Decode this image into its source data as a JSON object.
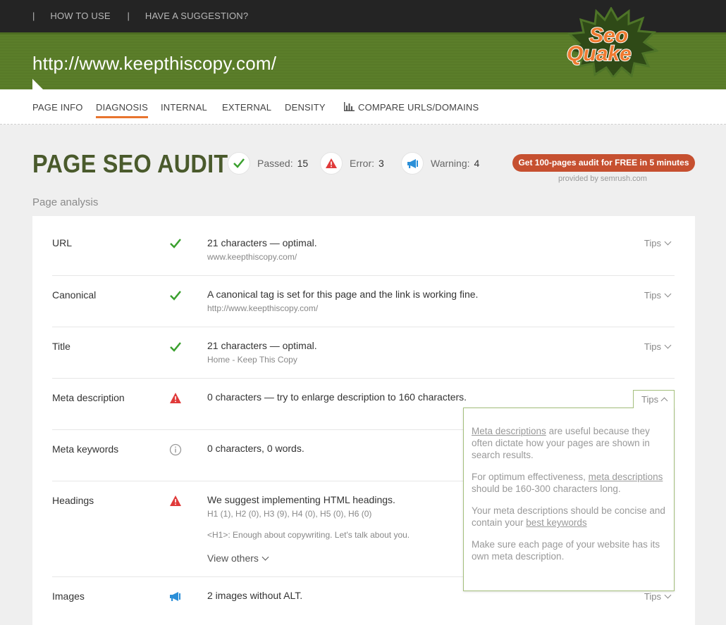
{
  "topnav": {
    "sep": "|",
    "how_to_use": "HOW TO USE",
    "suggestion": "HAVE A SUGGESTION?"
  },
  "site_url": "http://www.keepthiscopy.com/",
  "logo": {
    "line1": "Seo",
    "line2": "Quake"
  },
  "tabs": {
    "page_info": "PAGE INFO",
    "diagnosis": "DIAGNOSIS",
    "internal": "INTERNAL",
    "external": "EXTERNAL",
    "density": "DENSITY",
    "compare": "COMPARE URLS/DOMAINS"
  },
  "audit": {
    "title": "PAGE SEO AUDIT",
    "passed_label": "Passed:",
    "passed_count": "15",
    "error_label": "Error:",
    "error_count": "3",
    "warning_label": "Warning:",
    "warning_count": "4",
    "cta": "Get 100-pages audit for FREE in 5 minutes",
    "provided": "provided by  semrush.com"
  },
  "section_title": "Page analysis",
  "rows": [
    {
      "label": "URL",
      "status": "passed",
      "message": "21 characters — optimal.",
      "sub": "www.keepthiscopy.com/",
      "tips": "Tips"
    },
    {
      "label": "Canonical",
      "status": "passed",
      "message": "A canonical tag is set for this page and the link is working fine.",
      "sub": "http://www.keepthiscopy.com/",
      "tips": "Tips"
    },
    {
      "label": "Title",
      "status": "passed",
      "message": "21 characters — optimal.",
      "sub": "Home - Keep This Copy",
      "tips": "Tips"
    },
    {
      "label": "Meta description",
      "status": "error",
      "message": "0 characters — try to enlarge description to 160 characters.",
      "tips": "Tips"
    },
    {
      "label": "Meta keywords",
      "status": "info",
      "message": "0 characters, 0 words."
    },
    {
      "label": "Headings",
      "status": "error",
      "message": "We suggest implementing HTML headings.",
      "sub": "H1 (1), H2 (0), H3 (9), H4 (0), H5 (0), H6 (0)",
      "sub2": "<H1>: Enough about copywriting. Let's talk about you.",
      "view_others": "View others"
    },
    {
      "label": "Images",
      "status": "warning",
      "message": "2 images without ALT.",
      "tips": "Tips"
    }
  ],
  "popup": {
    "p1_link": "Meta descriptions",
    "p1_rest": " are useful because they often dictate how your pages are shown in search results.",
    "p2_start": "For optimum effectiveness, ",
    "p2_link": "meta descriptions",
    "p2_rest": " should be 160-300 characters long.",
    "p3_start": "Your meta descriptions should be concise and contain your ",
    "p3_link": "best keywords",
    "p4": "Make sure each page of your website has its own meta description."
  },
  "colors": {
    "green_band": "#5b7e2a",
    "accent_orange": "#e8742e",
    "cta_red": "#c65030",
    "pass_green": "#3aa02e",
    "error_red": "#e03a3a",
    "warning_blue": "#2b8fd8"
  }
}
